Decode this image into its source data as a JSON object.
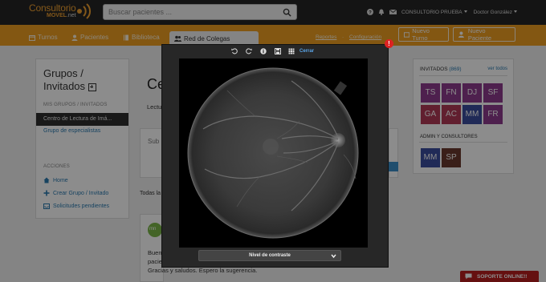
{
  "topbar": {
    "logo_main": "Consultorio",
    "logo_sub": "MOVEL",
    "logo_net": ".net",
    "search_placeholder": "Buscar pacientes ...",
    "account_label": "CONSULTORIO PRUEBA",
    "user_label": "Doctor González"
  },
  "nav": {
    "items": [
      {
        "label": "Turnos",
        "icon": "calendar-icon"
      },
      {
        "label": "Pacientes",
        "icon": "users-icon"
      },
      {
        "label": "Biblioteca",
        "icon": "book-icon"
      }
    ],
    "active": {
      "label": "Red de Colegas",
      "icon": "group-icon"
    },
    "links": [
      "Reportes",
      "Configuración"
    ],
    "separator": "·",
    "new_turn_label": "Nuevo Turno",
    "new_patient_label": "Nuevo Paciente"
  },
  "left_panel": {
    "title": "Grupos / Invitados",
    "section_groups": "MIS GRUPOS / INVITADOS",
    "active_group": "Centro de Lectura de Imá...",
    "group_specialists": "Grupo de especialistas",
    "section_actions": "ACCIONES",
    "actions": [
      "Home",
      "Crear Grupo / Invitado",
      "Solicitudes pendientes"
    ]
  },
  "middle": {
    "title_partial": "Ce",
    "subtitle_partial": "Lectu",
    "box_text_partial": "Sub",
    "tabs_partial": "Todas la",
    "avatar_text": "mn",
    "lines": [
      "Buen",
      "pacie",
      "Gracias y saludos. Espero la sugerencia."
    ]
  },
  "right_panel": {
    "invited_label": "INVITADOS",
    "invited_count": "(869)",
    "see_all": "ver todos",
    "tiles": [
      {
        "text": "TS",
        "color": "#8e3b8e"
      },
      {
        "text": "FN",
        "color": "#8e3b8e"
      },
      {
        "text": "DJ",
        "color": "#8e3b8e"
      },
      {
        "text": "SF",
        "color": "#8e3b8e"
      },
      {
        "text": "GA",
        "color": "#b13a57"
      },
      {
        "text": "AC",
        "color": "#b13a57"
      },
      {
        "text": "MM",
        "color": "#3b4e9e"
      },
      {
        "text": "FR",
        "color": "#8e3b8e"
      }
    ],
    "admins_label": "ADMIN Y CONSULTORES",
    "admins": [
      {
        "text": "MM",
        "color": "#3b4e9e"
      },
      {
        "text": "SP",
        "color": "#6b3a2e"
      }
    ]
  },
  "viewer": {
    "tools": [
      "rotate-left-icon",
      "rotate-right-icon",
      "info-icon",
      "save-icon",
      "grid-icon"
    ],
    "close_label": "Cerrar",
    "error_badge": "!",
    "contrast_label": "Nivel de contraste"
  },
  "support": {
    "label": "SOPORTE ONLINE!!"
  },
  "colors": {
    "topbar": "#262626",
    "nav": "#ee9f22",
    "link": "#2a7ab0",
    "support": "#b81e1e"
  }
}
